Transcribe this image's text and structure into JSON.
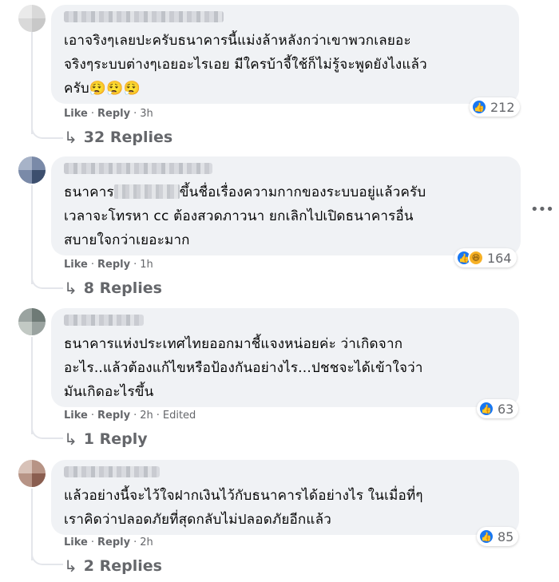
{
  "comments": [
    {
      "text": "เอาจริงๆเลยปะครับธนาคารนี้แม่งล้าหลังกว่าเขาพวกเลยอะ\nจริงๆระบบต่างๆเอยอะไรเอย มีใครบ้าจี้ใช้ก็ไม่รู้จะพูดยังไงแล้ว\nครับ",
      "emoji": "😮‍💨😮‍💨😮‍💨",
      "reaction_count": "212",
      "like_label": "Like",
      "reply_label": "Reply",
      "time": "3h",
      "replies_label": "32 Replies"
    },
    {
      "text_before": "ธนาคาร",
      "text_after": "ขึ้นชื่อเรื่องความกากของระบบอยู่แล้วครับ",
      "text_rest": "เวลาจะโทรหา cc ต้องสวดภาวนา ยกเลิกไปเปิดธนาคารอื่น\nสบายใจกว่าเยอะมาก",
      "reaction_count": "164",
      "like_label": "Like",
      "reply_label": "Reply",
      "time": "1h",
      "replies_label": "8 Replies"
    },
    {
      "text": "ธนาคารแห่งประเทศไทยออกมาชี้แจงหน่อยค่ะ ว่าเกิดจาก\nอะไร..แล้วต้องแก้ไขหรือป้องกันอย่างไร...ปชชจะได้เข้าใจว่า\nมันเกิดอะไรขึ้น",
      "reaction_count": "63",
      "like_label": "Like",
      "reply_label": "Reply",
      "time": "2h",
      "edited_label": "Edited",
      "replies_label": "1 Reply"
    },
    {
      "text": "แล้วอย่างนี้จะไว้ใจฝากเงินไว้กับธนาคารได้อย่างไร ในเมื่อที่ๆ\nเราคิดว่าปลอดภัยที่สุดกลับไม่ปลอดภัยอีกแล้ว",
      "reaction_count": "85",
      "like_label": "Like",
      "reply_label": "Reply",
      "time": "2h",
      "replies_label": "2 Replies"
    }
  ],
  "icons": {
    "like": "like-icon",
    "haha": "haha-icon",
    "reply_arrow": "reply-arrow-icon",
    "more": "more-options-icon"
  },
  "colors": {
    "bubble": "#f0f2f5",
    "like_blue": "#1877f2",
    "meta_gray": "#65676b"
  }
}
